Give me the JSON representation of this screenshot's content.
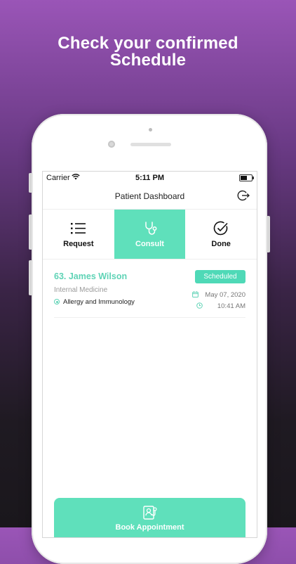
{
  "headline": {
    "line1": "Check your confirmed",
    "line2": "Schedule"
  },
  "status_bar": {
    "carrier": "Carrier",
    "time": "5:11 PM"
  },
  "nav": {
    "title": "Patient Dashboard",
    "logout_icon": "logout-icon"
  },
  "tabs": [
    {
      "label": "Request",
      "icon": "list-icon"
    },
    {
      "label": "Consult",
      "icon": "stethoscope-icon",
      "active": true
    },
    {
      "label": "Done",
      "icon": "check-circle-icon"
    }
  ],
  "appointment": {
    "title": "63. James Wilson",
    "department": "Internal Medicine",
    "specialty": "Allergy and Immunology",
    "status": "Scheduled",
    "date": "May 07, 2020",
    "time": "10:41 AM"
  },
  "book_button": {
    "label": "Book Appointment",
    "icon": "doctor-clipboard-icon"
  },
  "colors": {
    "accent": "#5fe0bb",
    "accent_text": "#5fd3b6",
    "bg_top": "#9a55b7",
    "bg_bottom": "#1a171c"
  }
}
